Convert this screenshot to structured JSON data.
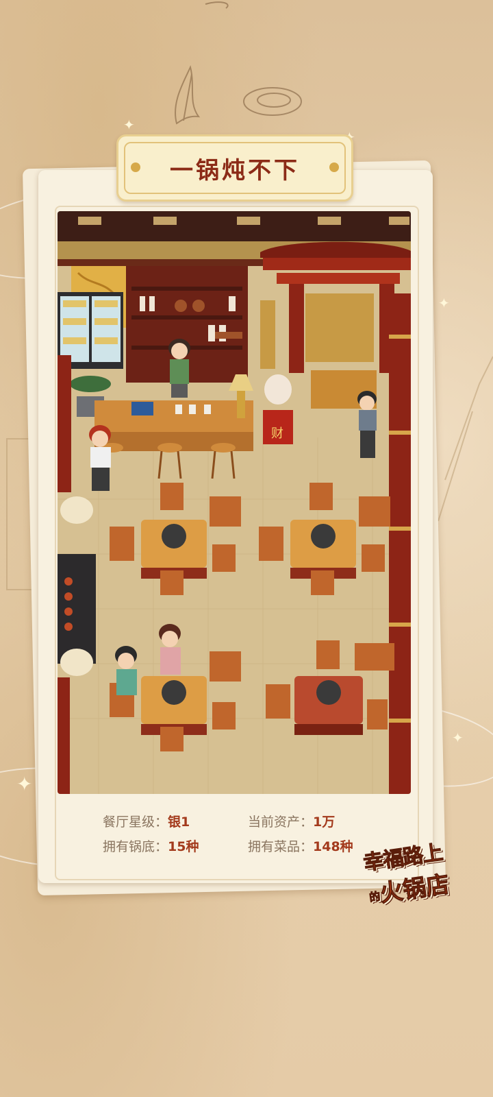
{
  "banner": {
    "title": "一锅炖不下"
  },
  "restaurant": {
    "cashier_sign": "财"
  },
  "stats": {
    "star_label": "餐厅星级：",
    "star_value": "银1",
    "assets_label": "当前资产：",
    "assets_value": "1万",
    "pots_label": "拥有锅底：",
    "pots_value": "15种",
    "dishes_label": "拥有菜品：",
    "dishes_value": "148种"
  },
  "logo": {
    "line1": "幸福路上",
    "line2_small": "的",
    "line2": "火锅店"
  },
  "colors": {
    "background": "#e2c9a2",
    "title_red": "#8c2b17",
    "value_red": "#a33a1c",
    "label_gray": "#8a7560",
    "floor": "#d8c394",
    "wood": "#8e2d1a"
  }
}
